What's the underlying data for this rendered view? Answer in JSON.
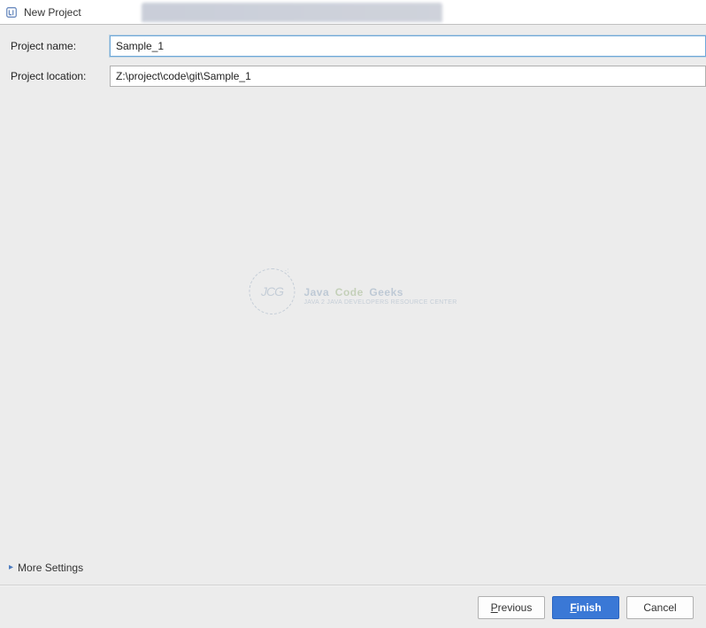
{
  "window": {
    "title": "New Project"
  },
  "form": {
    "project_name_label": "Project name:",
    "project_name_value": "Sample_1",
    "project_location_label": "Project location:",
    "project_location_value": "Z:\\project\\code\\git\\Sample_1"
  },
  "watermark": {
    "circle": "JCG",
    "word1": "Java",
    "word2": "Code",
    "word3": "Geeks",
    "tagline": "Java 2 Java Developers Resource Center"
  },
  "more_settings": {
    "label": "More Settings"
  },
  "buttons": {
    "previous": "Previous",
    "previous_prefix": "P",
    "previous_rest": "revious",
    "finish": "Finish",
    "finish_prefix": "F",
    "finish_rest": "inish",
    "cancel": "Cancel"
  }
}
